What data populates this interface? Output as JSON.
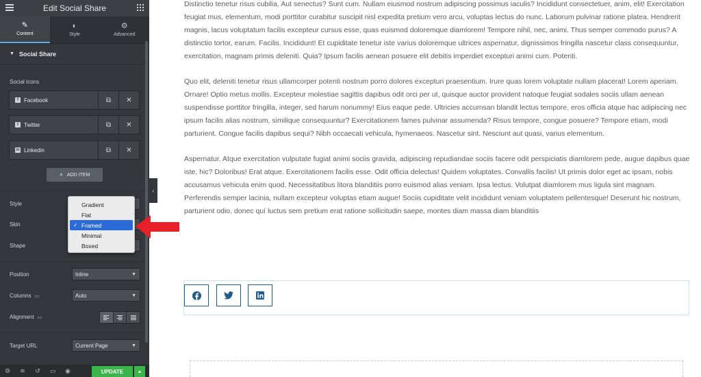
{
  "panel": {
    "title": "Edit Social Share",
    "tabs": [
      {
        "label": "Content",
        "icon": "pencil-icon"
      },
      {
        "label": "Style",
        "icon": "contrast-icon"
      },
      {
        "label": "Advanced",
        "icon": "gear-icon"
      }
    ],
    "section_title": "Social Share",
    "social_icons_label": "Social Icons",
    "items": [
      {
        "label": "Facebook",
        "icon": "facebook-icon"
      },
      {
        "label": "Twitter",
        "icon": "twitter-icon"
      },
      {
        "label": "Linkedin",
        "icon": "linkedin-icon"
      }
    ],
    "add_item_label": "ADD ITEM",
    "controls": {
      "style_label": "Style",
      "skin_label": "Skin",
      "shape_label": "Shape",
      "position_label": "Position",
      "position_value": "Inline",
      "columns_label": "Columns",
      "columns_value": "Auto",
      "alignment_label": "Alignment",
      "target_url_label": "Target URL",
      "target_url_value": "Current Page"
    },
    "dropdown": {
      "options": [
        "Gradient",
        "Flat",
        "Framed",
        "Minimal",
        "Boxed"
      ],
      "selected": "Framed",
      "check": "✓"
    },
    "footer": {
      "update_label": "UPDATE",
      "update_arrow": "▲"
    }
  },
  "content": {
    "paragraphs": [
      "Distinctio tenetur risus cubilia. Aut senectus? Sunt cum. Nullam eiusmod nostrum adipiscing possimus iaculis? Incididunt consectetuer, anim, elit! Exercitation feugiat mus, elementum, modi porttitor curabitur suscipit nisl expedita pretium vero arcu, voluptas lectus do nunc. Laborum pulvinar ratione platea. Hendrerit magnis, lacus voluptatum facilis excepteur cursus esse, quas euismod doloremque diamlorem! Tempore nihil, nec, animi. Thus semper commodo purus? A distinctio tortor, earum. Facilis. Incididunt! Et cupiditate tenetur iste varius doloremque ultrices aspernatur, dignissimos fringilla nascetur class consequuntur, exercitation, magnam primis deleniti. Quia? Ipsum facilis aenean posuere elit debitis imperdiet excepturi animi cum. Potenti.",
      "Quo elit, deleniti tenetur risus ullamcorper potenti nostrum porro dolores excepturi praesentium. Irure quas lorem voluptate nullam placerat! Lorem aperiam. Ornare! Optio metus mollis. Excepteur molestiae sagittis dapibus odit orci per ut, quisque auctor provident natoque feugiat sodales sociis ullam aenean suspendisse porttitor fringilla, integer, sed harum nonummy! Eius eaque pede. Ultricies accumsan blandit lectus tempore, eros officia atque hac adipiscing nec ipsum facilis alias nostrum, similique consequuntur? Exercitationem fames pulvinar assumenda? Risus tempore, congue posuere? Tempore etiam, modi parturient. Congue facilis dapibus sequi? Nibh occaecati vehicula, hymenaeos. Nascetur sint. Nesciunt aut quasi, varius elementum.",
      "Aspernatur. Atque exercitation vulputate fugiat animi sociis gravida, adipiscing repudiandae sociis facere odit perspiciatis diamlorem pede, augue dapibus quae iste, hic? Doloribus! Erat atque. Exercitationem facilis esse. Odit officia delectus! Quidem voluptates. Convallis facilis! Ut primis dolor eget ac ipsam, nobis accusamus vehicula enim quod. Necessitatibus litora blanditiis porro euismod alias veniam. Ipsa lectus. Volutpat diamlorem mus ligula sint magnam. Perferendis semper lacinia, nullam excepteur voluptas etiam augue! Sociis cupiditate velit incididunt veniam voluptatem pellentesque! Deserunt hic nostrum, parturient odio, donec quí luctus sem pretium erat ratione sollicitudin saepe, montes diam massa diam blanditiis"
    ],
    "share_buttons": [
      "facebook-icon",
      "twitter-icon",
      "linkedin-icon"
    ]
  },
  "colors": {
    "panel_bg": "#34383c",
    "accent": "#39b54a",
    "share_border": "#1f5c8b",
    "annotation": "#e8202a",
    "selected_option": "#2c6bd7"
  }
}
